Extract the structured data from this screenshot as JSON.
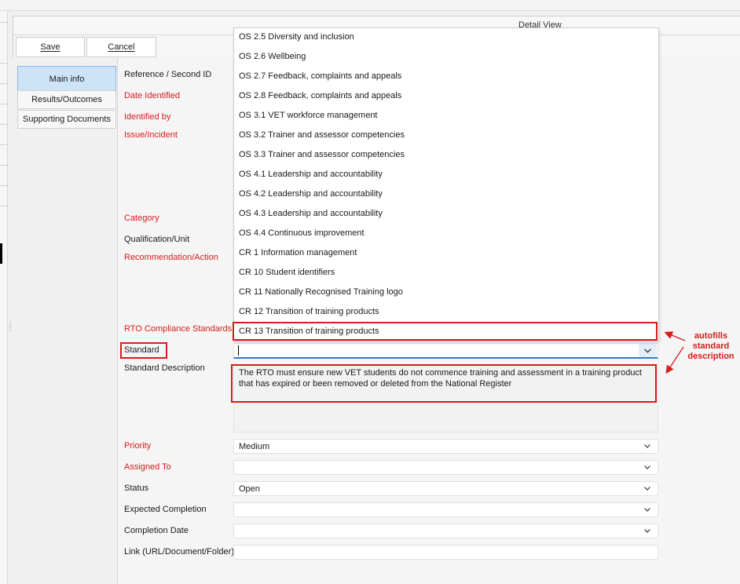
{
  "window": {
    "panel_title": "Detail View"
  },
  "toolbar": {
    "save_label": "Save",
    "cancel_label": "Cancel"
  },
  "tabs": [
    {
      "label": "Main info",
      "active": true
    },
    {
      "label": "Results/Outcomes",
      "active": false
    },
    {
      "label": "Supporting Documents",
      "active": false
    }
  ],
  "form": {
    "labels": {
      "reference": "Reference / Second ID",
      "date_identified": "Date Identified",
      "identified_by": "Identified by",
      "issue": "Issue/Incident",
      "category": "Category",
      "qualification": "Qualification/Unit",
      "recommendation": "Recommendation/Action",
      "rto_standards": "RTO Compliance Standards",
      "standard": "Standard",
      "standard_description": "Standard Description",
      "priority": "Priority",
      "assigned_to": "Assigned To",
      "status": "Status",
      "expected_completion": "Expected Completion",
      "completion_date": "Completion Date",
      "link": "Link (URL/Document/Folder)"
    },
    "values": {
      "rto_standards": "CR 13 Transition of training products",
      "standard": "",
      "standard_description": "The RTO must ensure new VET students do not commence training and assessment in a training product that has expired or been removed or deleted from the National Register",
      "priority": "Medium",
      "assigned_to": "",
      "status": "Open",
      "expected_completion": "",
      "completion_date": "",
      "link": ""
    }
  },
  "dropdown": {
    "options": [
      "OS 2.5 Diversity and inclusion",
      "OS 2.6 Wellbeing",
      "OS 2.7 Feedback, complaints and appeals",
      "OS 2.8 Feedback, complaints and appeals",
      "OS 3.1 VET workforce management",
      "OS 3.2 Trainer and assessor competencies",
      "OS 3.3 Trainer and assessor competencies",
      "OS 4.1 Leadership and accountability",
      "OS 4.2 Leadership and accountability",
      "OS 4.3 Leadership and accountability",
      "OS 4.4 Continuous improvement",
      "CR 1 Information management",
      "CR 10 Student identifiers",
      "CR 11 Nationally Recognised Training logo",
      "CR 12 Transition of training products"
    ]
  },
  "annotation": {
    "text_line1": "autofills",
    "text_line2": "standard",
    "text_line3": "description",
    "color": "#d81b1b"
  },
  "icons": {
    "dropdown_chevron": "chevron-down-icon"
  }
}
